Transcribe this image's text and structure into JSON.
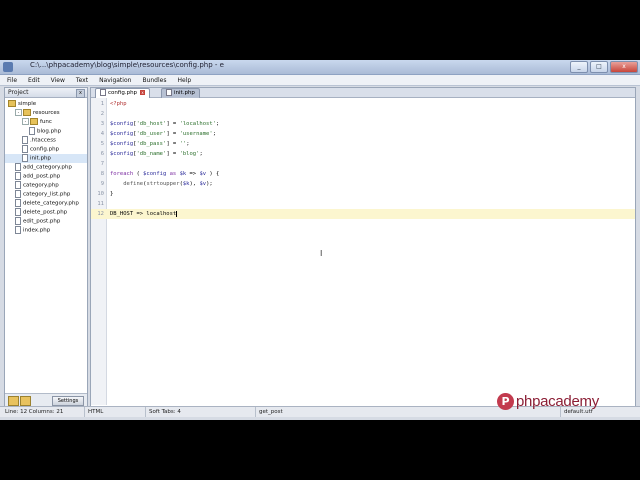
{
  "window": {
    "title": "C:\\...\\phpacademy\\blog\\simple\\resources\\config.php - e",
    "buttons": [
      "_",
      "□",
      "x"
    ]
  },
  "menubar": [
    "File",
    "Edit",
    "View",
    "Text",
    "Navigation",
    "Bundles",
    "Help"
  ],
  "project_panel": {
    "header": "Project",
    "close": "x",
    "tree": [
      {
        "label": "simple",
        "type": "folder",
        "depth": 0,
        "expanded": true
      },
      {
        "label": "resources",
        "type": "folder",
        "depth": 1,
        "expanded": true
      },
      {
        "label": "func",
        "type": "folder",
        "depth": 2,
        "expanded": true
      },
      {
        "label": "blog.php",
        "type": "file",
        "depth": 3
      },
      {
        "label": ".htaccess",
        "type": "file",
        "depth": 2
      },
      {
        "label": "config.php",
        "type": "file",
        "depth": 2
      },
      {
        "label": "init.php",
        "type": "file",
        "depth": 2
      },
      {
        "label": "add_category.php",
        "type": "file",
        "depth": 1
      },
      {
        "label": "add_post.php",
        "type": "file",
        "depth": 1
      },
      {
        "label": "category.php",
        "type": "file",
        "depth": 1
      },
      {
        "label": "category_list.php",
        "type": "file",
        "depth": 1
      },
      {
        "label": "delete_category.php",
        "type": "file",
        "depth": 1
      },
      {
        "label": "delete_post.php",
        "type": "file",
        "depth": 1
      },
      {
        "label": "edit_post.php",
        "type": "file",
        "depth": 1
      },
      {
        "label": "index.php",
        "type": "file",
        "depth": 1
      }
    ],
    "settings_label": "Settings"
  },
  "tabs": [
    {
      "label": "config.php",
      "active": true
    },
    {
      "label": "init.php",
      "active": false
    }
  ],
  "code_lines": [
    {
      "n": "1",
      "text": "<?php"
    },
    {
      "n": "2",
      "text": ""
    },
    {
      "n": "3",
      "text": "$config['db_host'] = 'localhost';"
    },
    {
      "n": "4",
      "text": "$config['db_user'] = 'username';"
    },
    {
      "n": "5",
      "text": "$config['db_pass'] = '';"
    },
    {
      "n": "6",
      "text": "$config['db_name'] = 'blog';"
    },
    {
      "n": "7",
      "text": ""
    },
    {
      "n": "8",
      "text": "foreach ( $config as $k => $v ) {"
    },
    {
      "n": "9",
      "text": "    define(strtoupper($k), $v);"
    },
    {
      "n": "10",
      "text": "}"
    },
    {
      "n": "11",
      "text": ""
    },
    {
      "n": "12",
      "text": "DB_HOST => localhost"
    }
  ],
  "current_line": 12,
  "statusbar": {
    "position": "Line: 12 Columns: 21",
    "syntax": "HTML",
    "tabs": "Soft Tabs: 4",
    "symbol": "get_post",
    "encoding": "default.utf"
  },
  "watermark": {
    "mark": "P",
    "text": "phpacademy"
  },
  "colors": {
    "accent": "#8b1e35",
    "current_line": "#fcf6cf"
  }
}
